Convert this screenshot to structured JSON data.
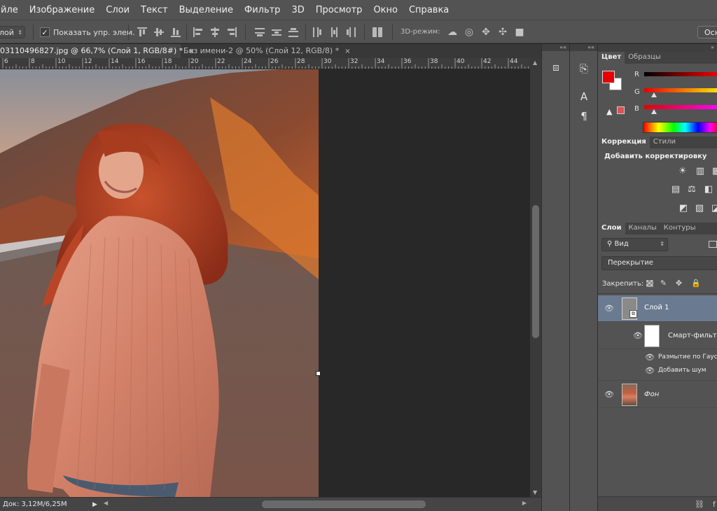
{
  "menu": [
    "йле",
    "Изображение",
    "Слои",
    "Текст",
    "Выделение",
    "Фильтр",
    "3D",
    "Просмотр",
    "Окно",
    "Справка"
  ],
  "options": {
    "layer_select": "лой",
    "show_controls_label": "Показать упр. элем.",
    "show_controls_checked": true,
    "mode3d_label": "3D-режим:",
    "main_button": "Осно"
  },
  "tabs": [
    {
      "label": "03110496827.jpg @ 66,7% (Слой 1, RGB/8#) *",
      "close": "×",
      "active": true
    },
    {
      "label": "Без имени-2 @ 50% (Слой 12, RGB/8) *",
      "close": "×",
      "active": false
    }
  ],
  "ruler": [
    "6",
    "8",
    "10",
    "12",
    "14",
    "16",
    "18",
    "20",
    "22",
    "24",
    "26",
    "28",
    "30",
    "32",
    "34",
    "36",
    "38",
    "40",
    "42",
    "44"
  ],
  "status": {
    "doc_size": "Док: 3,12M/6,25M",
    "arrow": "▶"
  },
  "color_panel": {
    "tabs": [
      "Цвет",
      "Образцы"
    ],
    "foreground": "#e60000",
    "background": "#ffffff",
    "channels": [
      {
        "label": "R",
        "gradient": "linear-gradient(90deg,#000000,#ff0000)"
      },
      {
        "label": "G",
        "gradient": "linear-gradient(90deg,#e60000,#ffea00)"
      },
      {
        "label": "B",
        "gradient": "linear-gradient(90deg,#e60000,#ff00ff)"
      }
    ]
  },
  "adjustments_panel": {
    "tabs": [
      "Коррекция",
      "Стили"
    ],
    "title": "Добавить корректировку"
  },
  "layers_panel": {
    "tabs": [
      "Слои",
      "Каналы",
      "Контуры"
    ],
    "filter_kind": "Вид",
    "blend_mode": "Перекрытие",
    "lock_label": "Закрепить:",
    "layers": [
      {
        "name": "Слой 1"
      },
      {
        "name": "Смарт-фильтры"
      },
      {
        "name": "Размытие по Гаусс"
      },
      {
        "name": "Добавить шум"
      },
      {
        "name": "Фон"
      }
    ]
  },
  "icons": {
    "eye": "eye-icon",
    "lock": "lock-icon",
    "link": "link-icon"
  }
}
